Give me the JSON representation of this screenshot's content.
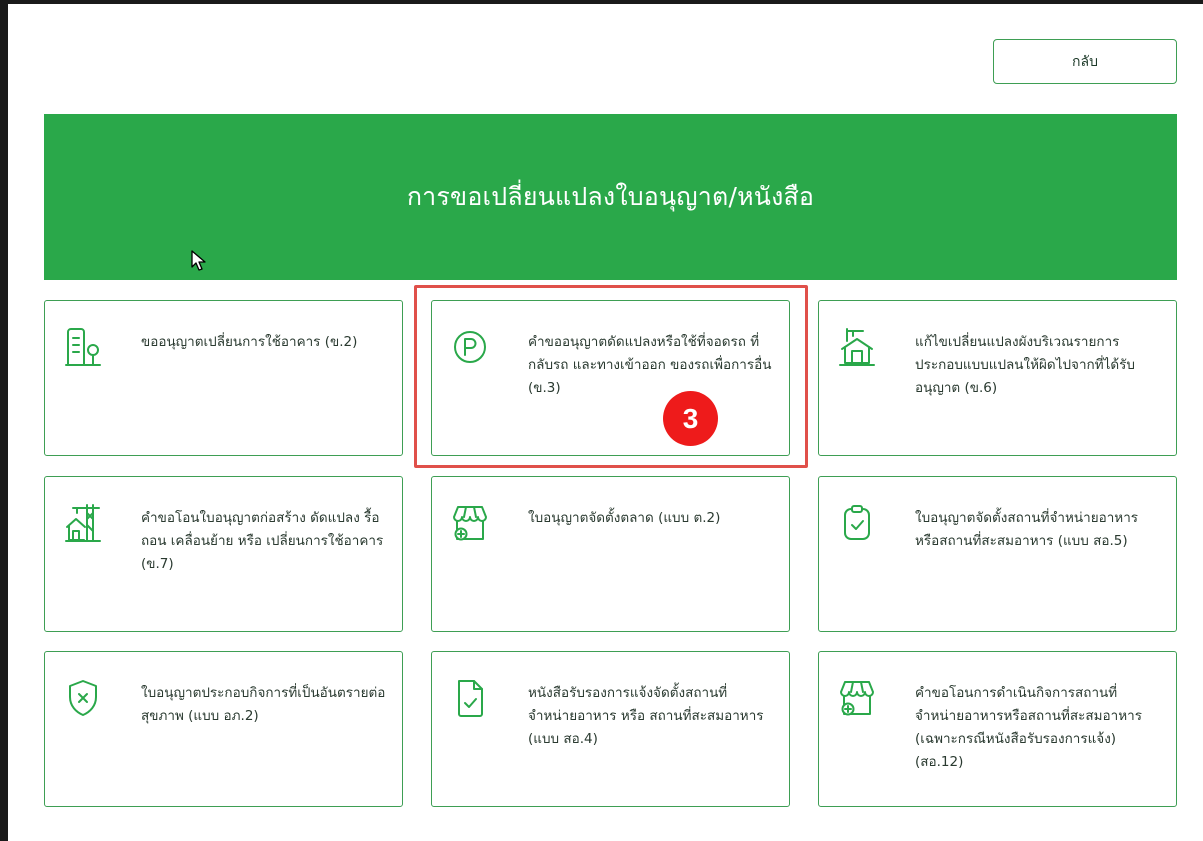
{
  "header": {
    "back_label": "กลับ"
  },
  "banner": {
    "title": "การขอเปลี่ยนแปลงใบอนุญาต/หนังสือ"
  },
  "annotation": {
    "step_number": "3"
  },
  "colors": {
    "brand_green": "#2aa84a",
    "border_green": "#3e9e54",
    "highlight_red": "#e0504a",
    "badge_red": "#ee1b1b"
  },
  "cards": [
    {
      "label": "ขออนุญาตเปลี่ยนการใช้อาคาร (ข.2)",
      "icon": "building-icon"
    },
    {
      "label": "คำขออนุญาตดัดแปลงหรือใช้ที่จอดรถ ที่กลับรถ และทางเข้าออก ของรถเพื่อการอื่น (ข.3)",
      "icon": "parking-icon"
    },
    {
      "label": "แก้ไขเปลี่ยนแปลงผังบริเวณรายการประกอบแบบแปลนให้ผิดไปจากที่ได้รับอนุญาต (ข.6)",
      "icon": "house-crane-icon"
    },
    {
      "label": "คำขอโอนใบอนุญาตก่อสร้าง ดัดแปลง รื้อถอน เคลื่อนย้าย หรือ เปลี่ยนการใช้อาคาร (ข.7)",
      "icon": "construction-crane-icon"
    },
    {
      "label": "ใบอนุญาตจัดตั้งตลาด (แบบ ต.2)",
      "icon": "market-stall-icon"
    },
    {
      "label": "ใบอนุญาตจัดตั้งสถานที่จำหน่ายอาหาร หรือสถานที่สะสมอาหาร (แบบ สอ.5)",
      "icon": "clipboard-check-icon"
    },
    {
      "label": "ใบอนุญาตประกอบกิจการที่เป็นอันตรายต่อสุขภาพ (แบบ อภ.2)",
      "icon": "shield-x-icon"
    },
    {
      "label": "หนังสือรับรองการแจ้งจัดตั้งสถานที่จำหน่ายอาหาร หรือ สถานที่สะสมอาหาร (แบบ สอ.4)",
      "icon": "document-check-icon"
    },
    {
      "label": "คำขอโอนการดำเนินกิจการสถานที่จำหน่ายอาหารหรือสถานที่สะสมอาหาร (เฉพาะกรณีหนังสือรับรองการแจ้ง) (สอ.12)",
      "icon": "market-stall-add-icon"
    }
  ]
}
